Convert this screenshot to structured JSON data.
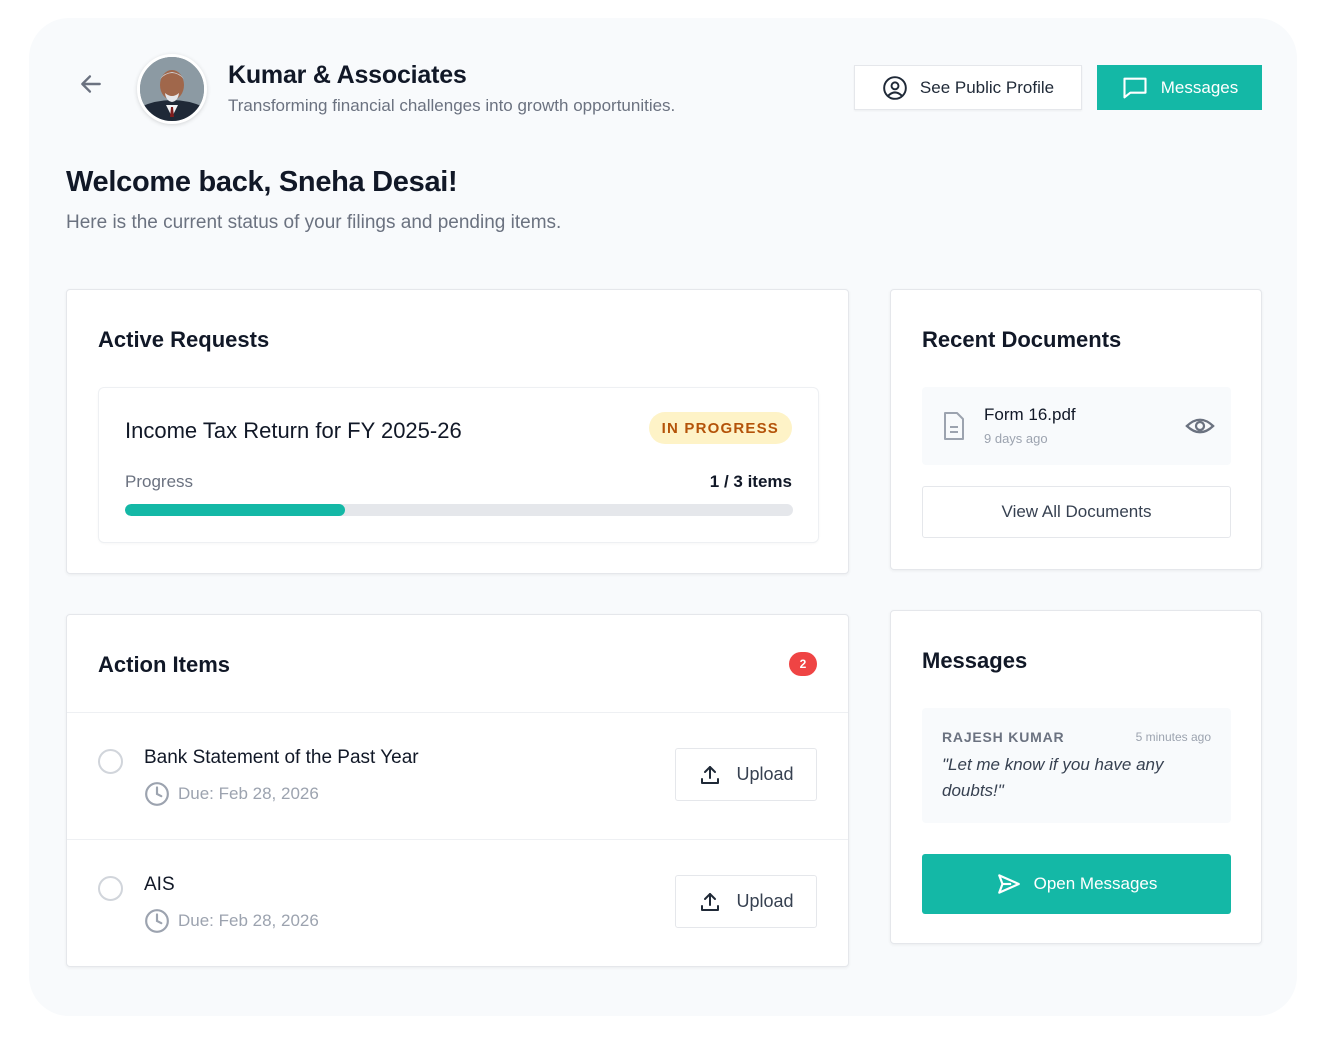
{
  "header": {
    "back_icon": "arrow-left-icon",
    "firm_name": "Kumar & Associates",
    "tagline": "Transforming financial challenges into growth opportunities.",
    "public_profile_label": "See Public Profile",
    "messages_label": "Messages"
  },
  "welcome": {
    "title": "Welcome back, Sneha Desai!",
    "subtitle": "Here is the current status of your filings and pending items."
  },
  "active_requests": {
    "title": "Active Requests",
    "request": {
      "title": "Income Tax Return for FY 2025-26",
      "status": "IN PROGRESS",
      "progress_label": "Progress",
      "progress_count": "1 / 3 items",
      "progress_fraction": 0.33
    }
  },
  "action_items": {
    "title": "Action Items",
    "count": "2",
    "items": [
      {
        "title": "Bank Statement of the Past Year",
        "due": "Due: Feb 28, 2026",
        "upload_label": "Upload"
      },
      {
        "title": "AIS",
        "due": "Due: Feb 28, 2026",
        "upload_label": "Upload"
      }
    ]
  },
  "recent_documents": {
    "title": "Recent Documents",
    "documents": [
      {
        "name": "Form 16.pdf",
        "time": "9 days ago"
      }
    ],
    "view_all_label": "View All Documents"
  },
  "messages": {
    "title": "Messages",
    "latest": {
      "sender": "RAJESH KUMAR",
      "time": "5 minutes ago",
      "text": "\"Let me know if you have any doubts!\""
    },
    "open_label": "Open Messages"
  },
  "colors": {
    "accent": "#14b8a6",
    "badge_bg": "#fef3c7",
    "badge_text": "#b45309",
    "alert": "#ef4444"
  }
}
